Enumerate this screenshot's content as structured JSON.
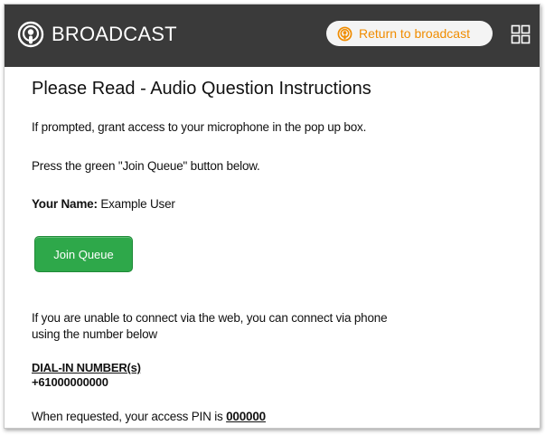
{
  "header": {
    "brand_icon": "podcast-icon",
    "title": "BROADCAST",
    "return_button": {
      "icon": "podcast-icon",
      "label": "Return to broadcast",
      "color": "#f08c00"
    },
    "fullscreen_icon": "fullscreen-icon",
    "background": "#3a3a3a"
  },
  "main": {
    "title": "Please Read - Audio Question Instructions",
    "instruction_1": "If prompted, grant access to your microphone in the pop up box.",
    "instruction_2": "Press the green \"Join Queue\" button below.",
    "name_label": "Your Name:",
    "name_value": "Example User",
    "join_button": {
      "label": "Join Queue",
      "color": "#2ea84a"
    },
    "phone_line_1": "If you are unable to connect via the web, you can connect via phone",
    "phone_line_2": "using the number below",
    "dialin_label": "DIAL-IN NUMBER(s)",
    "dialin_number": "+61000000000",
    "pin_text": "When requested, your access PIN is",
    "pin_value": "000000"
  }
}
